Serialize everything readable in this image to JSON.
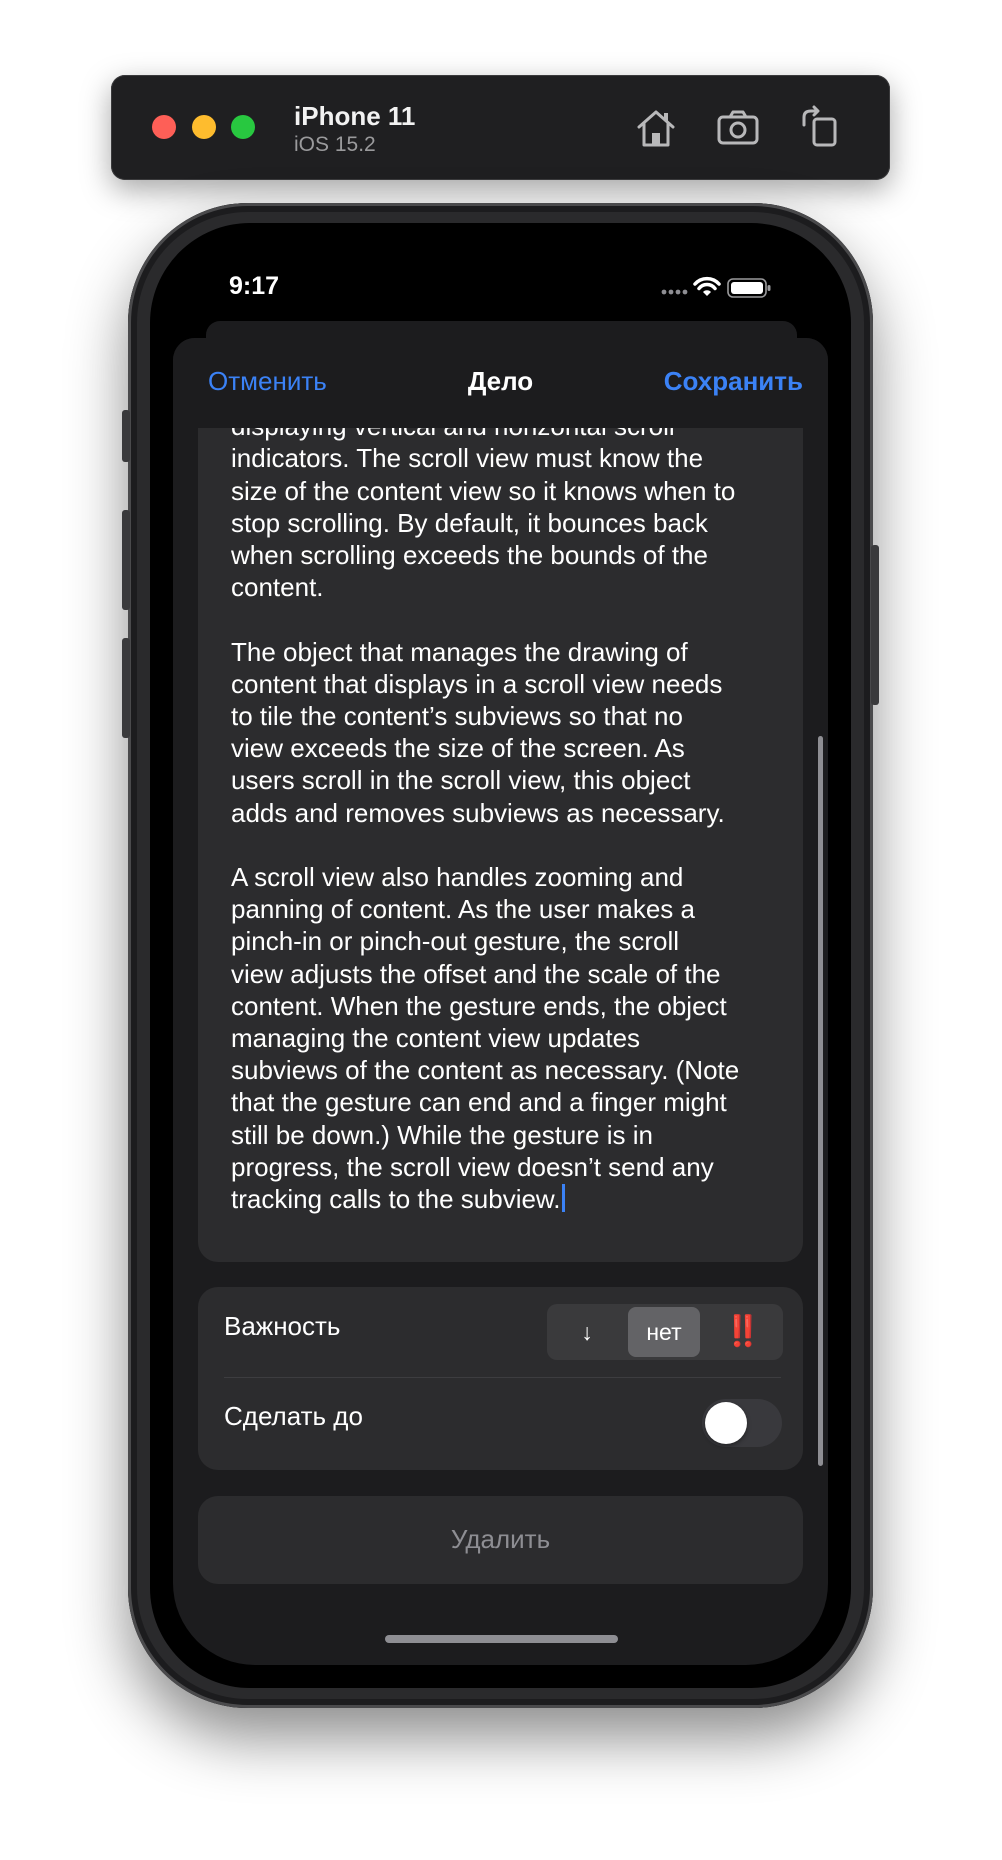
{
  "simulator": {
    "device_name": "iPhone 11",
    "os_version": "iOS 15.2",
    "icons": [
      "home-icon",
      "screenshot-icon",
      "rotate-icon"
    ]
  },
  "status_bar": {
    "time": "9:17"
  },
  "nav": {
    "cancel": "Отменить",
    "title": "Дело",
    "save": "Сохранить"
  },
  "note": {
    "text": "scroll view itself does no drawing except for\ndisplaying vertical and horizontal scroll\nindicators. The scroll view must know the\nsize of the content view so it knows when to\nstop scrolling. By default, it bounces back\nwhen scrolling exceeds the bounds of the\ncontent.\n\nThe object that manages the drawing of\ncontent that displays in a scroll view needs\nto tile the content’s subviews so that no\nview exceeds the size of the screen. As\nusers scroll in the scroll view, this object\nadds and removes subviews as necessary.\n\nA scroll view also handles zooming and\npanning of content. As the user makes a\npinch-in or pinch-out gesture, the scroll\nview adjusts the offset and the scale of the\ncontent. When the gesture ends, the object\nmanaging the content view updates\nsubviews of the content as necessary. (Note\nthat the gesture can end and a finger might\nstill be down.) While the gesture is in\nprogress, the scroll view doesn’t send any\ntracking calls to the subview."
  },
  "settings": {
    "importance_label": "Важность",
    "importance_options": [
      "↓",
      "нет",
      "‼️"
    ],
    "importance_selected": "нет",
    "deadline_label": "Сделать до",
    "deadline_enabled": false
  },
  "delete": {
    "label": "Удалить"
  },
  "colors": {
    "accent": "#3b82f6",
    "danger": "#ff3b30",
    "background": "#1c1c1e",
    "card": "#2c2c2e"
  }
}
